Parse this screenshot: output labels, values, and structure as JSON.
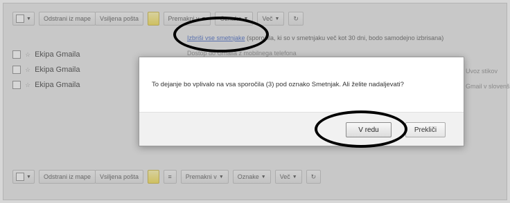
{
  "toolbar_top": {
    "archive": "Odstrani iz mape",
    "spam": "Vsiljena pošta",
    "move": "Premakni v",
    "labels": "Oznake",
    "more": "Več"
  },
  "toolbar_bottom": {
    "archive": "Odstrani iz mape",
    "spam": "Vsiljena pošta",
    "move": "Premakni v",
    "labels": "Oznake",
    "more": "Več"
  },
  "notice": {
    "link": "Izbriši vse smetnjake",
    "text": "(sporočila, ki so v smetnjaku več kot 30 dni, bodo samodejno izbrisana)"
  },
  "messages": [
    {
      "sender": "Ekipa Gmaila"
    },
    {
      "sender": "Ekipa Gmaila"
    },
    {
      "sender": "Ekipa Gmaila"
    }
  ],
  "background_snippets": {
    "line1": "Dostop do Gmaila z mobilnega telefona",
    "line2": "Uvoz stikov",
    "line3": "Gmail v slovenščini"
  },
  "dialog": {
    "message": "To dejanje bo vplivalo na vsa sporočila (3) pod oznako Smetnjak. Ali želite nadaljevati?",
    "ok": "V redu",
    "cancel": "Prekliči"
  },
  "accent": "#000000"
}
